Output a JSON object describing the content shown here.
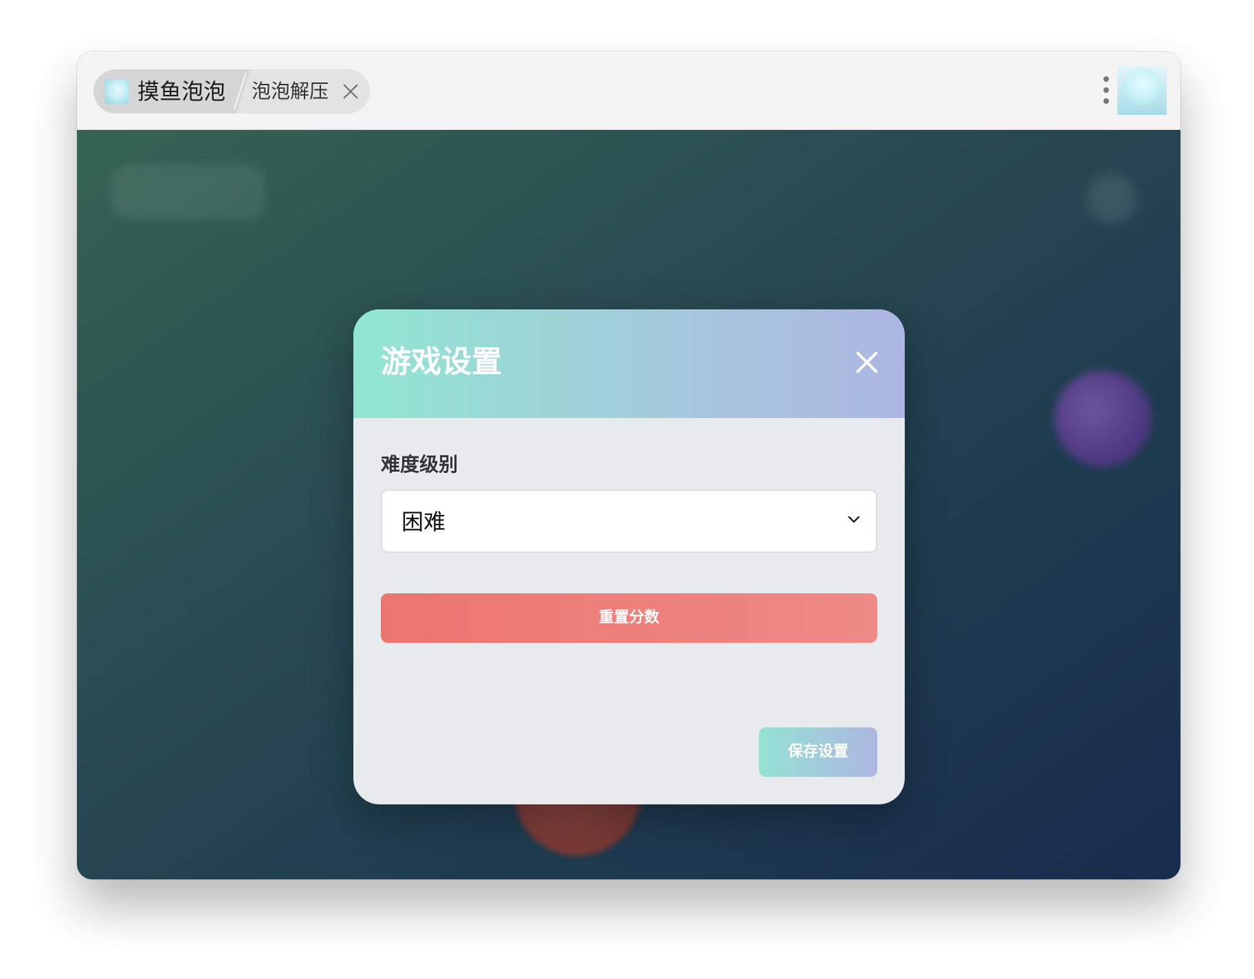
{
  "window": {
    "tab": {
      "title": "摸鱼泡泡",
      "subtitle": "泡泡解压"
    }
  },
  "modal": {
    "title": "游戏设置",
    "difficulty_label": "难度级别",
    "difficulty_value": "困难",
    "reset_label": "重置分数",
    "save_label": "保存设置"
  },
  "colors": {
    "header_gradient": [
      "#91e6d2",
      "#adb6e2"
    ],
    "reset_gradient": [
      "#ec756f",
      "#ef8a86"
    ],
    "save_gradient": [
      "#95e2d4",
      "#adb7e0"
    ],
    "background_gradient": [
      "#356452",
      "#182c4d"
    ]
  },
  "icons": {
    "tab_close": "close-icon",
    "menu": "more-vertical-icon",
    "modal_close": "close-icon",
    "select": "chevron-down-icon"
  }
}
